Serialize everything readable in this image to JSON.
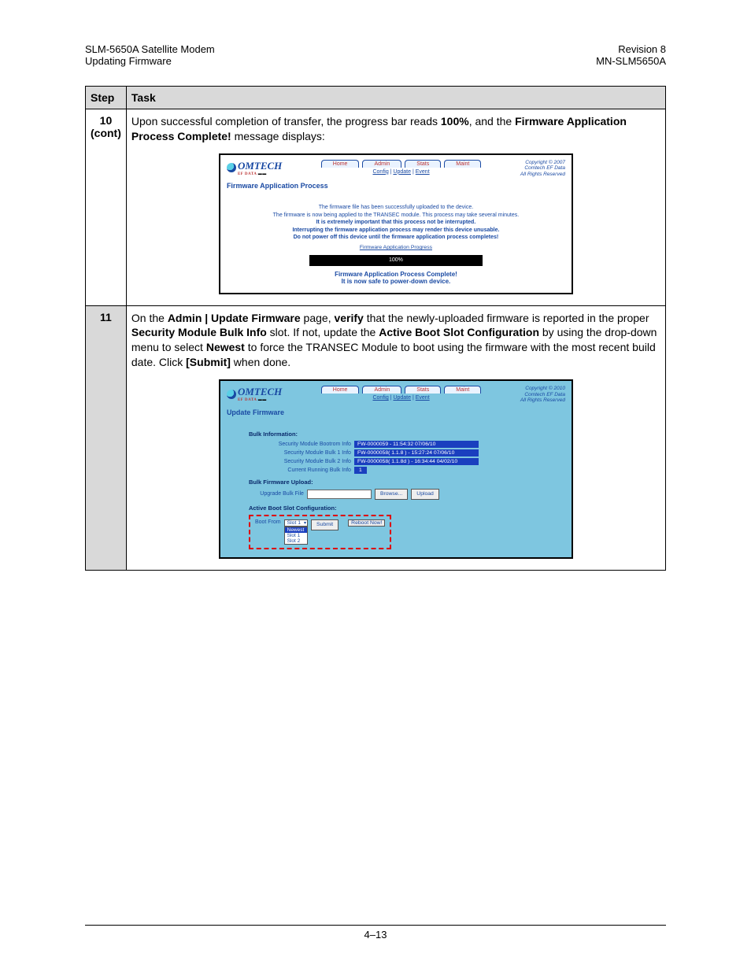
{
  "header": {
    "left1": "SLM-5650A Satellite Modem",
    "left2": "Updating Firmware",
    "right1": "Revision 8",
    "right2": "MN-SLM5650A"
  },
  "table": {
    "col_step": "Step",
    "col_task": "Task"
  },
  "row10": {
    "step_a": "10",
    "step_b": "(cont)",
    "intro_a": "Upon successful completion of transfer,  the progress bar reads ",
    "intro_b": "100%",
    "intro_c": ", and the ",
    "intro_d": "Firmware Application Process Complete!",
    "intro_e": " message displays:"
  },
  "shot1": {
    "logo": "OMTECH",
    "logo_sub": "EF DATA",
    "tabs": {
      "home": "Home",
      "admin": "Admin",
      "stats": "Stats",
      "maint": "Maint"
    },
    "sublinks": {
      "config": "Config",
      "update": "Update",
      "event": "Event"
    },
    "copy_a": "Copyright © 2007",
    "copy_b": "Comtech EF Data",
    "copy_c": "All Rights Reserved",
    "title": "Firmware Application Process",
    "m1": "The firmware file has been successfully uploaded to the device.",
    "m2": "The firmware is now being applied to the TRANSEC module. This process may take several minutes.",
    "m3": "It is extremely important that this process not be interrupted.",
    "m4": "Interrupting the firmware application process may render this device unusable.",
    "m5": "Do not power off this device until the firmware application process completes!",
    "link": "Firmware Application Progress",
    "pct": "100%",
    "done_a": "Firmware Application Process Complete!",
    "done_b": "It is now safe to power-down device."
  },
  "row11": {
    "step": "11",
    "p_a": "On the ",
    "p_b": "Admin | Update Firmware",
    "p_c": " page, ",
    "p_d": "verify",
    "p_e": " that the newly-uploaded firmware is reported in the proper ",
    "p_f": "Security Module Bulk Info",
    "p_g": " slot.  If not, update the ",
    "p_h": "Active Boot Slot Configuration",
    "p_i": " by using the drop-down menu to select ",
    "p_j": "Newest",
    "p_k": " to force the TRANSEC Module to boot using the firmware with the most recent build date. Click ",
    "p_l": "[Submit]",
    "p_m": " when done."
  },
  "shot2": {
    "logo": "OMTECH",
    "logo_sub": "EF DATA",
    "tabs": {
      "home": "Home",
      "admin": "Admin",
      "stats": "Stats",
      "maint": "Maint"
    },
    "sublinks": {
      "config": "Config",
      "update": "Update",
      "event": "Event"
    },
    "copy_a": "Copyright © 2010",
    "copy_b": "Comtech EF Data",
    "copy_c": "All Rights Reserved",
    "title": "Update Firmware",
    "grp_bulk": "Bulk Information:",
    "bi": {
      "bootrom_l": "Security Module Bootrom Info",
      "bootrom_v": "FW-0000059 - 11:54:32 07/06/10",
      "b1_l": "Security Module Bulk 1 Info",
      "b1_v": "FW-0000058( 1.1.8 ) - 15:27:24 07/06/10",
      "b2_l": "Security Module Bulk 2 Info",
      "b2_v": "FW-0000058( 1.1.8d ) - 16:34:44 04/02/10",
      "run_l": "Current Running Bulk Info",
      "run_v": "1"
    },
    "grp_upload": "Bulk Firmware Upload:",
    "upload_l": "Upgrade Bulk File",
    "browse": "Browse...",
    "upload_btn": "Upload",
    "grp_boot": "Active Boot Slot Configuration:",
    "boot_l": "Boot From",
    "sel_val": "Slot 1",
    "opts": {
      "newest": "Newest",
      "slot1": "Slot 1",
      "slot2": "Slot 2"
    },
    "submit": "Submit",
    "reboot": "Reboot Now!"
  },
  "footer": {
    "page": "4–13"
  }
}
